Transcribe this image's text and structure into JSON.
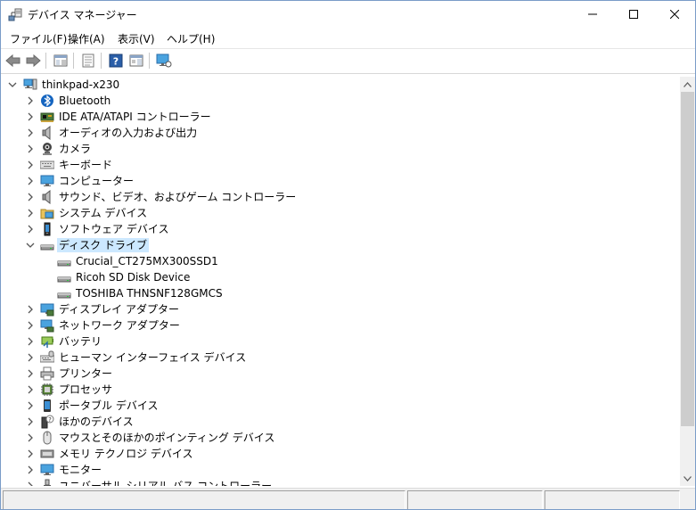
{
  "window": {
    "title": "デバイス マネージャー"
  },
  "menu": [
    {
      "label": "ファイル(F)"
    },
    {
      "label": "操作(A)"
    },
    {
      "label": "表示(V)"
    },
    {
      "label": "ヘルプ(H)"
    }
  ],
  "tree": {
    "root": {
      "label": "thinkpad-x230",
      "icon": "computer-icon",
      "expanded": true
    },
    "categories": [
      {
        "label": "Bluetooth",
        "icon": "bluetooth-icon",
        "expanded": false
      },
      {
        "label": "IDE ATA/ATAPI コントローラー",
        "icon": "ide-controller-icon",
        "expanded": false
      },
      {
        "label": "オーディオの入力および出力",
        "icon": "speaker-icon",
        "expanded": false
      },
      {
        "label": "カメラ",
        "icon": "camera-icon",
        "expanded": false
      },
      {
        "label": "キーボード",
        "icon": "keyboard-icon",
        "expanded": false
      },
      {
        "label": "コンピューター",
        "icon": "monitor-icon",
        "expanded": false
      },
      {
        "label": "サウンド、ビデオ、およびゲーム コントローラー",
        "icon": "speaker-icon",
        "expanded": false
      },
      {
        "label": "システム デバイス",
        "icon": "system-folder-icon",
        "expanded": false
      },
      {
        "label": "ソフトウェア デバイス",
        "icon": "software-device-icon",
        "expanded": false
      },
      {
        "label": "ディスク ドライブ",
        "icon": "disk-drive-icon",
        "expanded": true,
        "selected": true,
        "children": [
          {
            "label": "Crucial_CT275MX300SSD1",
            "icon": "disk-drive-icon"
          },
          {
            "label": "Ricoh SD Disk Device",
            "icon": "disk-drive-icon"
          },
          {
            "label": "TOSHIBA THNSNF128GMCS",
            "icon": "disk-drive-icon"
          }
        ]
      },
      {
        "label": "ディスプレイ アダプター",
        "icon": "display-adapter-icon",
        "expanded": false
      },
      {
        "label": "ネットワーク アダプター",
        "icon": "network-adapter-icon",
        "expanded": false
      },
      {
        "label": "バッテリ",
        "icon": "battery-icon",
        "expanded": false
      },
      {
        "label": "ヒューマン インターフェイス デバイス",
        "icon": "hid-icon",
        "expanded": false
      },
      {
        "label": "プリンター",
        "icon": "printer-icon",
        "expanded": false
      },
      {
        "label": "プロセッサ",
        "icon": "processor-icon",
        "expanded": false
      },
      {
        "label": "ポータブル デバイス",
        "icon": "portable-device-icon",
        "expanded": false
      },
      {
        "label": "ほかのデバイス",
        "icon": "other-device-icon",
        "expanded": false
      },
      {
        "label": "マウスとそのほかのポインティング デバイス",
        "icon": "mouse-icon",
        "expanded": false
      },
      {
        "label": "メモリ テクノロジ デバイス",
        "icon": "memory-device-icon",
        "expanded": false
      },
      {
        "label": "モニター",
        "icon": "monitor-icon",
        "expanded": false
      },
      {
        "label": "ユニバーサル シリアル バス コントローラー",
        "icon": "usb-icon",
        "expanded": false
      }
    ]
  },
  "colors": {
    "selection": "#cce8ff",
    "window_border": "#7a9cc8",
    "status_bar": "#f0f0f0"
  }
}
